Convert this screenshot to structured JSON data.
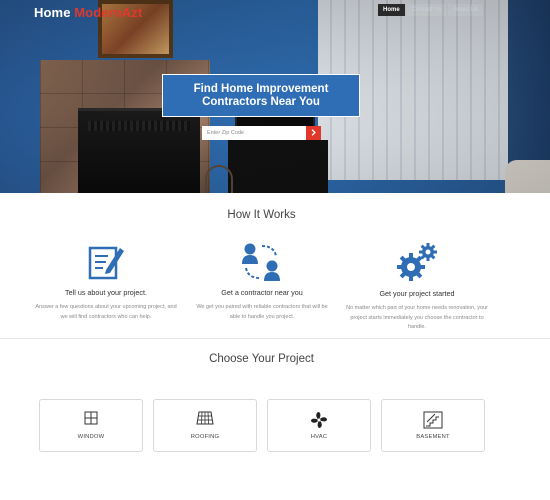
{
  "brand": {
    "part1": "Home",
    "part2": "ModernAzt"
  },
  "nav": [
    {
      "label": "Home",
      "active": true
    },
    {
      "label": "Contact Us",
      "active": false
    },
    {
      "label": "About Us",
      "active": false
    }
  ],
  "hero": {
    "heading": "Find Home Improvement Contractors Near You",
    "zip_placeholder": "Enter Zip Code",
    "submit_icon": "arrow-right-icon"
  },
  "how_it_works": {
    "title": "How It Works",
    "steps": [
      {
        "icon": "form-edit-icon",
        "title": "Tell us about your project.",
        "text": "Answer a few questions about your upcoming project, and we will find contractors who can help."
      },
      {
        "icon": "people-connect-icon",
        "title": "Get a contractor near you",
        "text": "We get you paired with reliable contractors that will be able to handle you project."
      },
      {
        "icon": "gears-icon",
        "title": "Get your project started",
        "text": "No matter which part of your home needs renovation, your project starts immediately you choose the contractor to handle."
      }
    ]
  },
  "choose": {
    "title": "Choose Your Project",
    "projects": [
      {
        "label": "WINDOW",
        "icon": "window-icon"
      },
      {
        "label": "ROOFING",
        "icon": "roof-tiles-icon"
      },
      {
        "label": "HVAC",
        "icon": "fan-icon"
      },
      {
        "label": "BASEMENT",
        "icon": "stairs-icon"
      }
    ]
  },
  "colors": {
    "primary_blue": "#2f6db5",
    "accent_red": "#e0382b",
    "icon_blue": "#2f6db5"
  }
}
